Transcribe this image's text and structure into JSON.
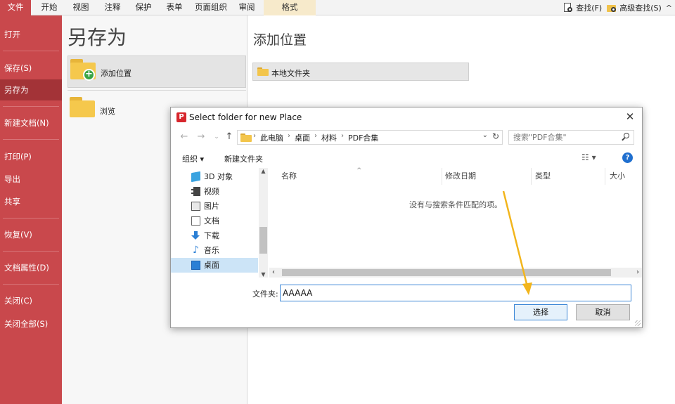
{
  "ribbon": {
    "tabs": [
      "文件",
      "开始",
      "视图",
      "注释",
      "保护",
      "表单",
      "页面组织",
      "审阅",
      "格式"
    ],
    "find_label": "查找(F)",
    "advanced_find_label": "高级查找(S)",
    "overflow": "^"
  },
  "nav": {
    "items": [
      "打开",
      "保存(S)",
      "另存为",
      "新建文档(N)",
      "打印(P)",
      "导出",
      "共享",
      "恢复(V)",
      "文档属性(D)",
      "关闭(C)",
      "关闭全部(S)"
    ],
    "active": "另存为"
  },
  "middle": {
    "title": "另存为",
    "add_location": "添加位置",
    "browse": "浏览"
  },
  "right_panel": {
    "title": "添加位置",
    "local_folder": "本地文件夹"
  },
  "dialog": {
    "title": "Select folder for new Place",
    "breadcrumb": [
      "此电脑",
      "桌面",
      "材料",
      "PDF合集"
    ],
    "search_placeholder": "搜索\"PDF合集\"",
    "organize": "组织 ▾",
    "new_folder": "新建文件夹",
    "tree": [
      "3D 对象",
      "视频",
      "图片",
      "文档",
      "下载",
      "音乐",
      "桌面"
    ],
    "tree_selected": "桌面",
    "columns": [
      "名称",
      "修改日期",
      "类型",
      "大小"
    ],
    "empty_message": "没有与搜索条件匹配的项。",
    "folder_label": "文件夹:",
    "folder_value": "AAAAA",
    "select_button": "选择",
    "cancel_button": "取消"
  },
  "colors": {
    "nav_bg": "#c9484c",
    "nav_active": "#a33337",
    "accent_blue": "#3b86d6",
    "annotation_arrow": "#f2b51c"
  }
}
